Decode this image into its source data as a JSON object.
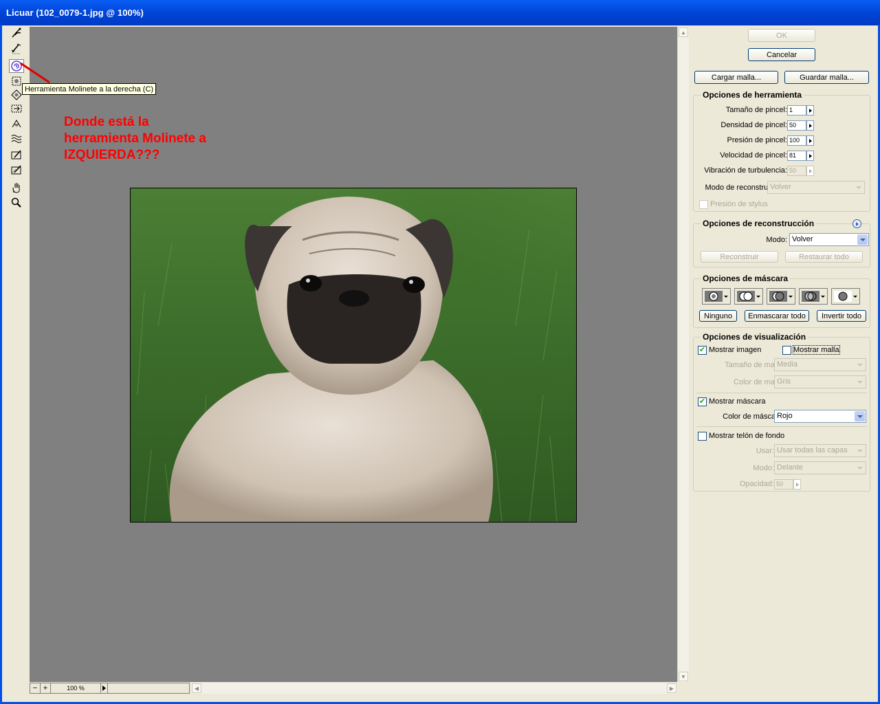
{
  "window": {
    "title": "Licuar (102_0079-1.jpg @ 100%)"
  },
  "toolbar": {
    "tools": [
      {
        "icon": "warp-icon"
      },
      {
        "icon": "reconstruct-icon"
      },
      {
        "icon": "twirl-clockwise-icon",
        "active": true
      },
      {
        "icon": "pucker-icon"
      },
      {
        "icon": "bloat-icon"
      },
      {
        "icon": "shift-pixels-icon"
      },
      {
        "icon": "reflection-icon"
      },
      {
        "icon": "turbulence-icon"
      },
      {
        "icon": "freeze-mask-icon"
      },
      {
        "icon": "thaw-mask-icon"
      },
      {
        "icon": "hand-icon"
      },
      {
        "icon": "zoom-icon"
      }
    ],
    "tooltip": "Herramienta Molinete a la derecha (C)"
  },
  "annotation": {
    "text": "Donde está la\nherramienta Molinete a\nIZQUIERDA???",
    "color": "#ff0000"
  },
  "zoom": {
    "minus": "−",
    "plus": "+",
    "value": "100 %"
  },
  "panel": {
    "ok": "OK",
    "cancel": "Cancelar",
    "load_mesh": "Cargar malla...",
    "save_mesh": "Guardar malla...",
    "tool_options": {
      "title": "Opciones de herramienta",
      "brush_size_label": "Tamaño de pincel:",
      "brush_size": "1",
      "brush_density_label": "Densidad de pincel:",
      "brush_density": "50",
      "brush_pressure_label": "Presión de pincel:",
      "brush_pressure": "100",
      "brush_rate_label": "Velocidad de pincel:",
      "brush_rate": "81",
      "turbulent_jitter_label": "Vibración de turbulencia:",
      "turbulent_jitter": "50",
      "reconstruct_mode_label": "Modo de reconstrucción:",
      "reconstruct_mode": "Volver",
      "stylus_pressure_label": "Presión de stylus"
    },
    "reconstruct_options": {
      "title": "Opciones de reconstrucción",
      "mode_label": "Modo:",
      "mode": "Volver",
      "reconstruct": "Reconstruir",
      "restore_all": "Restaurar todo"
    },
    "mask_options": {
      "title": "Opciones de máscara",
      "none": "Ninguno",
      "mask_all": "Enmascarar todo",
      "invert_all": "Invertir todo"
    },
    "view_options": {
      "title": "Opciones de visualización",
      "show_image": "Mostrar imagen",
      "show_mesh": "Mostrar malla",
      "mesh_size_label": "Tamaño de malla:",
      "mesh_size": "Media",
      "mesh_color_label": "Color de malla:",
      "mesh_color": "Gris",
      "show_mask": "Mostrar máscara",
      "mask_color_label": "Color de máscara:",
      "mask_color": "Rojo",
      "show_backdrop": "Mostrar telón de fondo",
      "use_label": "Usar:",
      "use": "Usar todas las capas",
      "mode_label": "Modo:",
      "mode": "Delante",
      "opacity_label": "Opacidad:",
      "opacity": "50"
    }
  },
  "colors": {
    "titlebar": "#0054e3",
    "canvas": "#808080",
    "annotation": "#ff0000",
    "panel": "#ece9d8"
  }
}
